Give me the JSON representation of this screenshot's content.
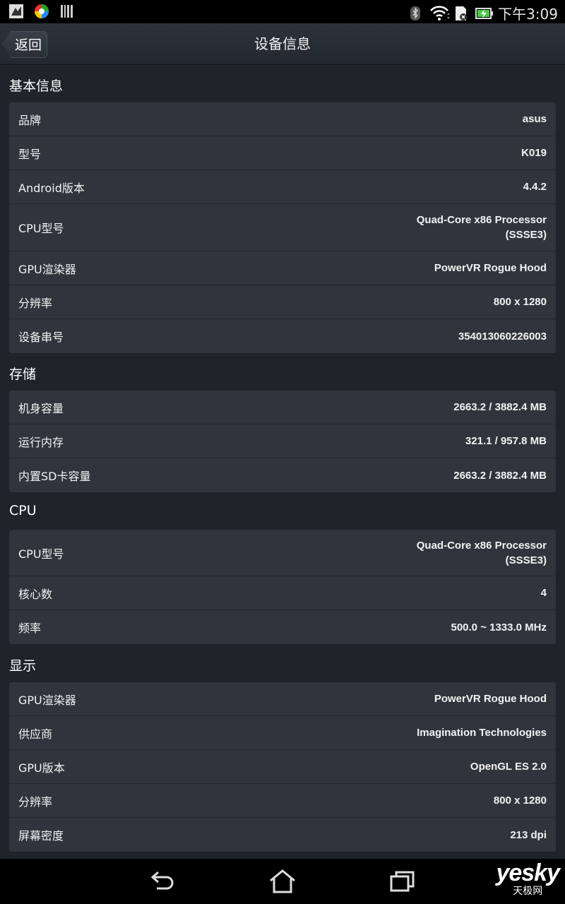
{
  "status_bar": {
    "time": "下午3:09",
    "icons": [
      "notification-app-icon",
      "colorful-app-icon",
      "barcode-icon",
      "bluetooth-icon",
      "wifi-icon",
      "sd-card-icon",
      "battery-charging-icon"
    ]
  },
  "action_bar": {
    "back_label": "返回",
    "title": "设备信息"
  },
  "sections": [
    {
      "title": "基本信息",
      "rows": [
        {
          "label": "品牌",
          "value": "asus"
        },
        {
          "label": "型号",
          "value": "K019"
        },
        {
          "label": "Android版本",
          "value": "4.4.2"
        },
        {
          "label": "CPU型号",
          "value": "Quad-Core x86 Processor\n(SSSE3)"
        },
        {
          "label": "GPU渲染器",
          "value": "PowerVR Rogue Hood"
        },
        {
          "label": "分辨率",
          "value": "800 x 1280"
        },
        {
          "label": "设备串号",
          "value": "354013060226003"
        }
      ]
    },
    {
      "title": "存储",
      "rows": [
        {
          "label": "机身容量",
          "value": "2663.2 / 3882.4 MB"
        },
        {
          "label": "运行内存",
          "value": "321.1 / 957.8 MB"
        },
        {
          "label": "内置SD卡容量",
          "value": "2663.2 / 3882.4 MB"
        }
      ]
    },
    {
      "title": "CPU",
      "rows": [
        {
          "label": "CPU型号",
          "value": "Quad-Core x86 Processor\n(SSSE3)"
        },
        {
          "label": "核心数",
          "value": "4"
        },
        {
          "label": "频率",
          "value": "500.0 ~ 1333.0 MHz"
        }
      ]
    },
    {
      "title": "显示",
      "rows": [
        {
          "label": "GPU渲染器",
          "value": "PowerVR Rogue Hood"
        },
        {
          "label": "供应商",
          "value": "Imagination Technologies"
        },
        {
          "label": "GPU版本",
          "value": "OpenGL ES 2.0"
        },
        {
          "label": "分辨率",
          "value": "800 x 1280"
        },
        {
          "label": "屏幕密度",
          "value": "213 dpi"
        }
      ]
    }
  ],
  "nav_bar": {
    "icons": [
      "back-nav-icon",
      "home-nav-icon",
      "recent-apps-icon"
    ]
  },
  "watermark": {
    "main": "yesky",
    "sub": "天极网"
  }
}
